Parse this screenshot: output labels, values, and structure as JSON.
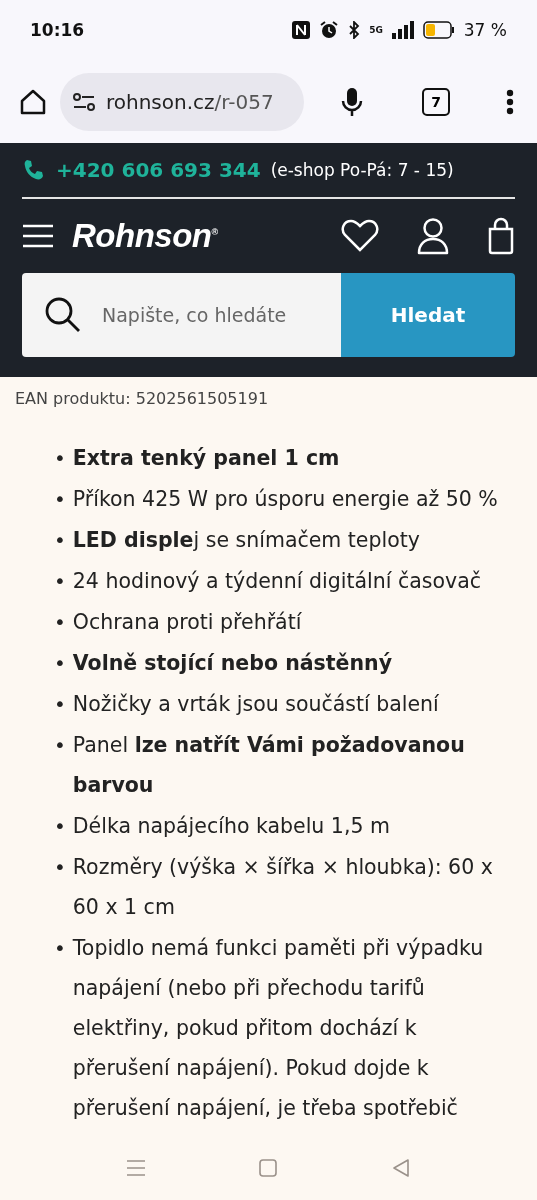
{
  "status_bar": {
    "time": "10:16",
    "network": "5G",
    "battery_text": "37 %"
  },
  "browser": {
    "url_host": "rohnson.cz",
    "url_path": "/r-057",
    "tab_count": "7"
  },
  "header": {
    "phone": "+420 606 693 344",
    "hours": "(e-shop Po-Pá: 7 - 15)",
    "logo": "Rohnson",
    "logo_mark": "®",
    "search": {
      "placeholder": "Napište, co hledáte"
    },
    "search_button": "Hledat"
  },
  "ean": "EAN produktu: 5202561505191",
  "features": [
    {
      "bullet": "•",
      "text": "Extra tenký panel 1 cm",
      "bold": true
    },
    {
      "bullet": "•",
      "text": "Příkon 425 W pro úsporu energie až 50 %",
      "bold": false
    },
    {
      "bullet": "•",
      "text": "**LED disple**j se snímačem teploty",
      "bold": false
    },
    {
      "bullet": "•",
      "text": "24 hodinový a týdenní digitální časovač",
      "bold": false
    },
    {
      "bullet": "•",
      "text": "Ochrana proti přehřátí",
      "bold": false
    },
    {
      "bullet": "•",
      "text": "Volně stojící nebo nástěnný",
      "bold": true
    },
    {
      "bullet": "•",
      "text": "Nožičky a vrták jsou součástí balení",
      "bold": false
    },
    {
      "bullet": "•",
      "text": "Panel **lze natřít Vámi požadovanou barvou**",
      "bold": false
    },
    {
      "bullet": "•",
      "text": "Délka napájecího kabelu 1,5 m",
      "bold": false
    },
    {
      "bullet": "•",
      "text": "Rozměry (výška × šířka × hloubka): 60 x 60 x 1 cm",
      "bold": false
    },
    {
      "bullet": "•",
      "text": "Topidlo nemá funkci paměti při výpadku napájení (nebo při přechodu tarifů elektřiny, pokud přitom dochází k přerušení napájení). Pokud dojde k přerušení napájení, je třeba spotřebič",
      "bold": false
    }
  ]
}
